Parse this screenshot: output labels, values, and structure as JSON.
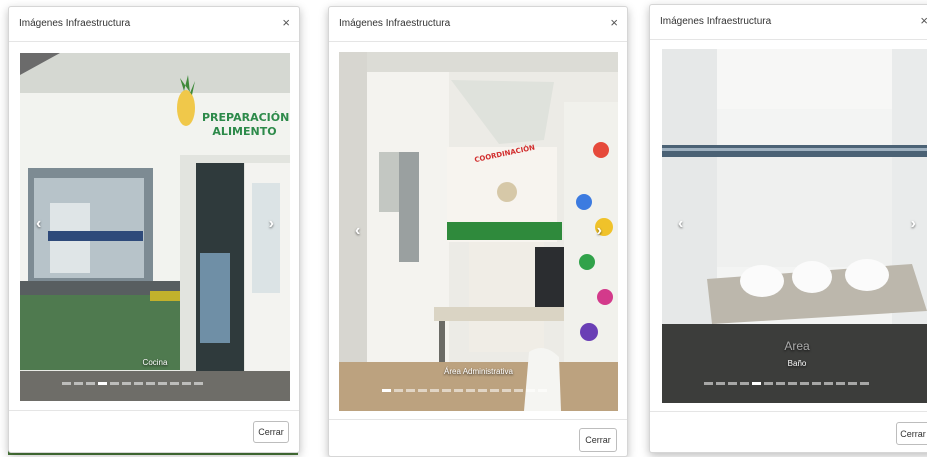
{
  "modals": [
    {
      "title": "Imágenes Infraestructura",
      "close": "×",
      "caption": "Cocina",
      "wall_sign": "PREPARACIÓN ALIMENTO",
      "prev": "‹",
      "next": "›",
      "close_button": "Cerrar",
      "indicator_count": 12,
      "active_indicator": 3
    },
    {
      "title": "Imágenes Infraestructura",
      "close": "×",
      "caption": "Área Administrativa",
      "wall_sign": "COORDINACIÓN",
      "prev": "‹",
      "next": "›",
      "close_button": "Cerrar",
      "indicator_count": 14,
      "active_indicator": 0
    },
    {
      "title": "Imágenes Infraestructura",
      "close": "×",
      "caption_area": "Area",
      "caption": "Baño",
      "prev": "‹",
      "next": "›",
      "close_button": "Cerrar",
      "indicator_count": 14,
      "active_indicator": 4
    }
  ]
}
